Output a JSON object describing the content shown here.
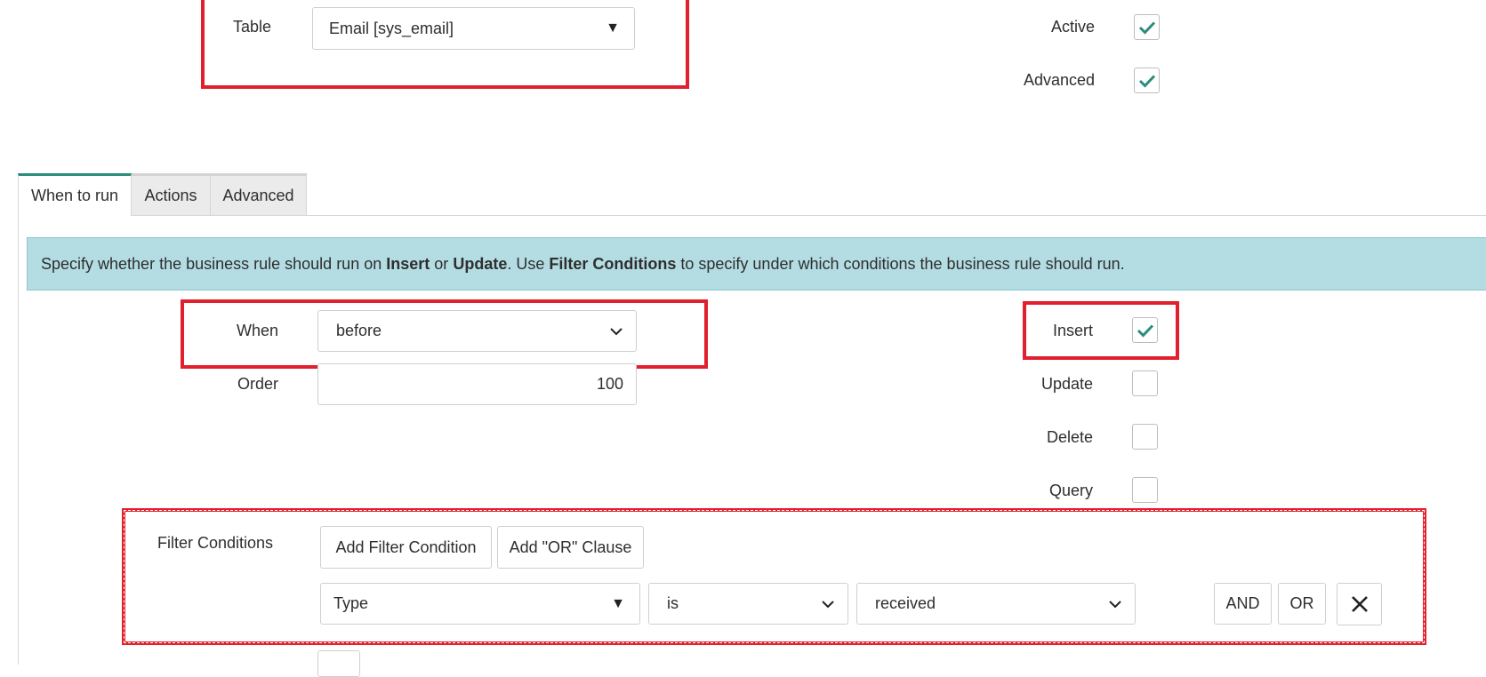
{
  "top": {
    "table_label": "Table",
    "table_value": "Email [sys_email]",
    "active_label": "Active",
    "active_checked": true,
    "advanced_label": "Advanced",
    "advanced_checked": true
  },
  "tabs": [
    {
      "label": "When to run",
      "active": true
    },
    {
      "label": "Actions",
      "active": false
    },
    {
      "label": "Advanced",
      "active": false
    }
  ],
  "info": {
    "part1": "Specify whether the business rule should run on ",
    "insert": "Insert",
    "or_text": " or ",
    "update": "Update",
    "part2": ". Use ",
    "filter_conditions": "Filter Conditions",
    "part3": " to specify under which conditions the business rule should run."
  },
  "form": {
    "when_label": "When",
    "when_value": "before",
    "order_label": "Order",
    "order_value": "100",
    "insert_label": "Insert",
    "insert_checked": true,
    "update_label": "Update",
    "update_checked": false,
    "delete_label": "Delete",
    "delete_checked": false,
    "query_label": "Query",
    "query_checked": false
  },
  "filter": {
    "label": "Filter Conditions",
    "add_condition": "Add Filter Condition",
    "add_or": "Add \"OR\" Clause",
    "field": "Type",
    "operator": "is",
    "value": "received",
    "and_label": "AND",
    "or_label": "OR"
  },
  "colors": {
    "accent": "#2a8c7e",
    "highlight": "#e21f2c",
    "info_bg": "#b4dde3"
  }
}
